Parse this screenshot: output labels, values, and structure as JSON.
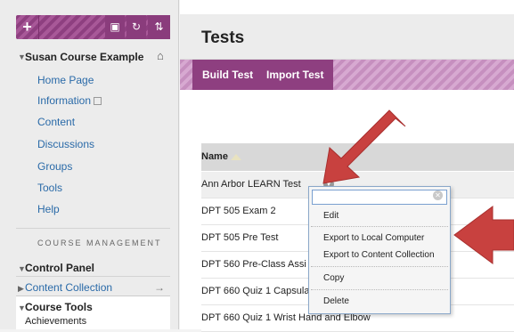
{
  "sidebar": {
    "toolbar": {
      "add_label": "+",
      "icon_folder": "folder-icon",
      "icon_refresh": "refresh-icon",
      "icon_sort": "sort-icon"
    },
    "course_title": "Susan Course Example",
    "items": [
      {
        "label": "Home Page"
      },
      {
        "label": "Information"
      },
      {
        "label": "Content"
      },
      {
        "label": "Discussions"
      },
      {
        "label": "Groups"
      },
      {
        "label": "Tools"
      },
      {
        "label": "Help"
      }
    ],
    "management_heading": "COURSE MANAGEMENT",
    "control_panel": "Control Panel",
    "content_collection": "Content Collection",
    "course_tools": "Course Tools",
    "achievements": "Achievements"
  },
  "main": {
    "title": "Tests",
    "actions": {
      "build": "Build Test",
      "import": "Import Test"
    },
    "table": {
      "col_name": "Name",
      "rows": [
        "Ann Arbor LEARN Test",
        "DPT 505 Exam 2",
        "DPT 505 Pre Test",
        "DPT 560 Pre-Class Assi",
        "DPT 660 Quiz 1 Capsula",
        "DPT 660 Quiz 1 Wrist Hand and Elbow"
      ]
    }
  },
  "context_menu": {
    "search_value": "",
    "items": {
      "edit": "Edit",
      "export_local": "Export to Local Computer",
      "export_collection": "Export to Content Collection",
      "copy": "Copy",
      "delete": "Delete"
    }
  },
  "colors": {
    "brand": "#8e3f80",
    "arrow": "#c8413f",
    "link": "#2a6aa8"
  }
}
